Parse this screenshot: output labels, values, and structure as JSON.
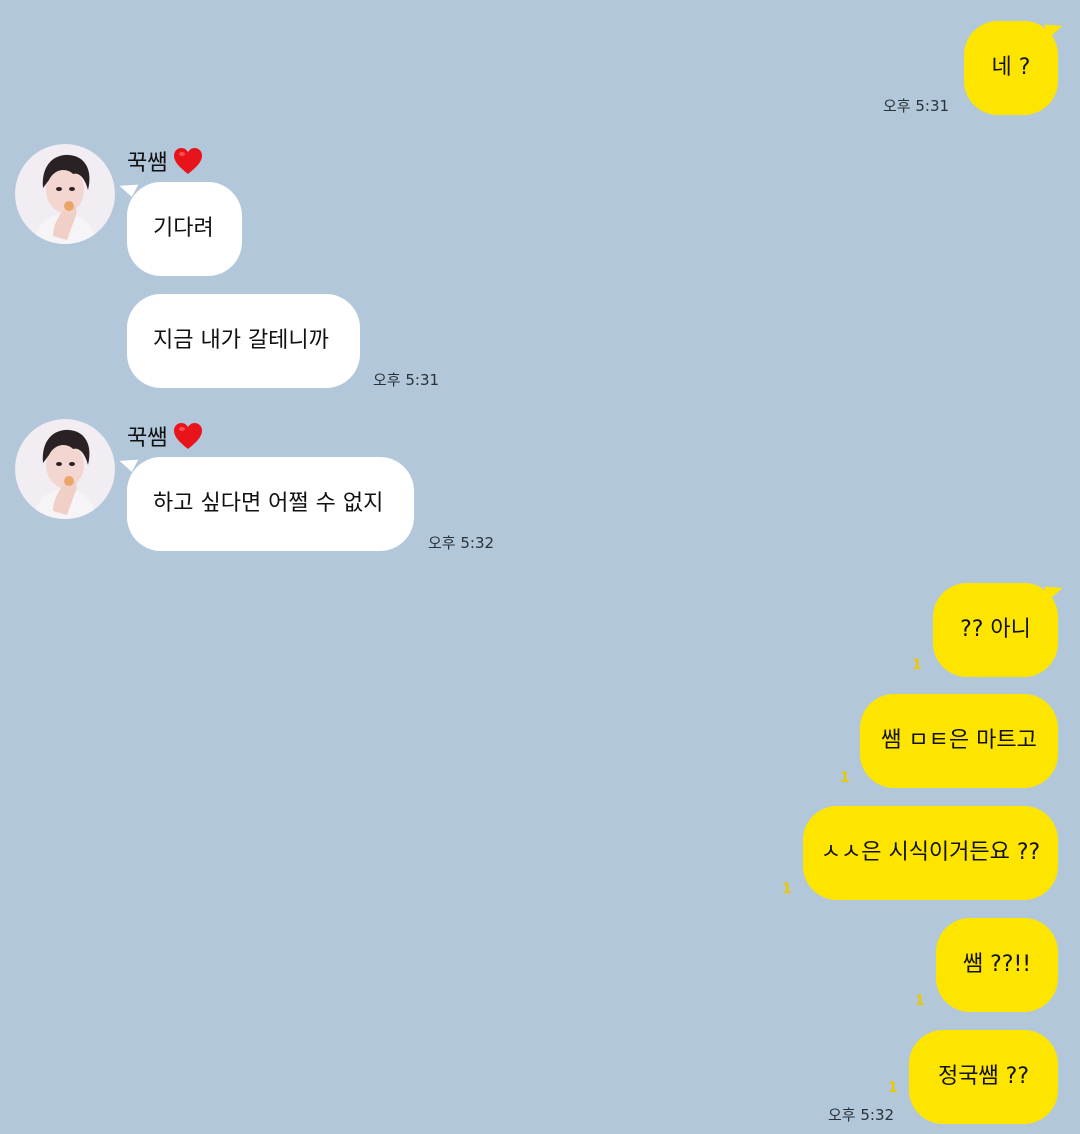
{
  "colors": {
    "background": "#b2c7da",
    "my_bubble": "#fee500",
    "their_bubble": "#ffffff",
    "read_count": "#e9c800"
  },
  "sender": {
    "name": "꾹쌤",
    "name_emoji": "heart-icon"
  },
  "messages": {
    "m1": {
      "text": "네 ?",
      "time": "오후 5:31"
    },
    "m2": {
      "text": "기다려"
    },
    "m3": {
      "text": "지금 내가 갈테니까",
      "time": "오후 5:31"
    },
    "m4": {
      "text": "하고 싶다면 어쩔 수 없지",
      "time": "오후 5:32"
    },
    "m5": {
      "text": "?? 아니",
      "read": "1"
    },
    "m6": {
      "text": "쌤 ㅁㅌ은 마트고",
      "read": "1"
    },
    "m7": {
      "text": "ㅅㅅ은 시식이거든요 ??",
      "read": "1"
    },
    "m8": {
      "text": "쌤 ??!!",
      "read": "1"
    },
    "m9": {
      "text": "정국쌤 ??",
      "read": "1",
      "time": "오후 5:32"
    }
  }
}
